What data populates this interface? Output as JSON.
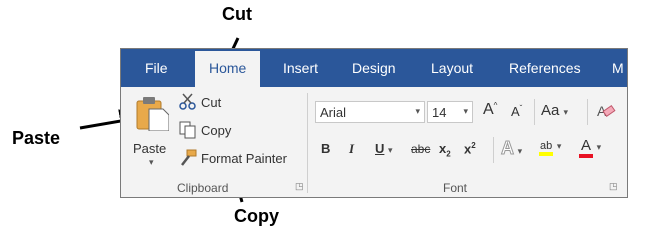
{
  "callouts": {
    "cut": "Cut",
    "paste": "Paste",
    "copy": "Copy"
  },
  "tabs": [
    "File",
    "Home",
    "Insert",
    "Design",
    "Layout",
    "References",
    "M"
  ],
  "clipboard": {
    "paste_label": "Paste",
    "cut_label": "Cut",
    "copy_label": "Copy",
    "format_painter_label": "Format Painter",
    "group_label": "Clipboard"
  },
  "font": {
    "font_name": "Arial",
    "font_size": "14",
    "grow_label": "A",
    "shrink_label": "A",
    "change_case_label": "Aa",
    "bold_label": "B",
    "italic_label": "I",
    "underline_label": "U",
    "strikethrough_label": "abc",
    "subscript_label": "x",
    "superscript_label": "x",
    "text_effects_label": "A",
    "highlight_label": "ab",
    "font_color_label": "A",
    "group_label": "Font"
  },
  "colors": {
    "tabbar": "#2b579a",
    "ribbon": "#f3f3f3",
    "highlight": "#ffff00",
    "font_color": "#e81123"
  }
}
